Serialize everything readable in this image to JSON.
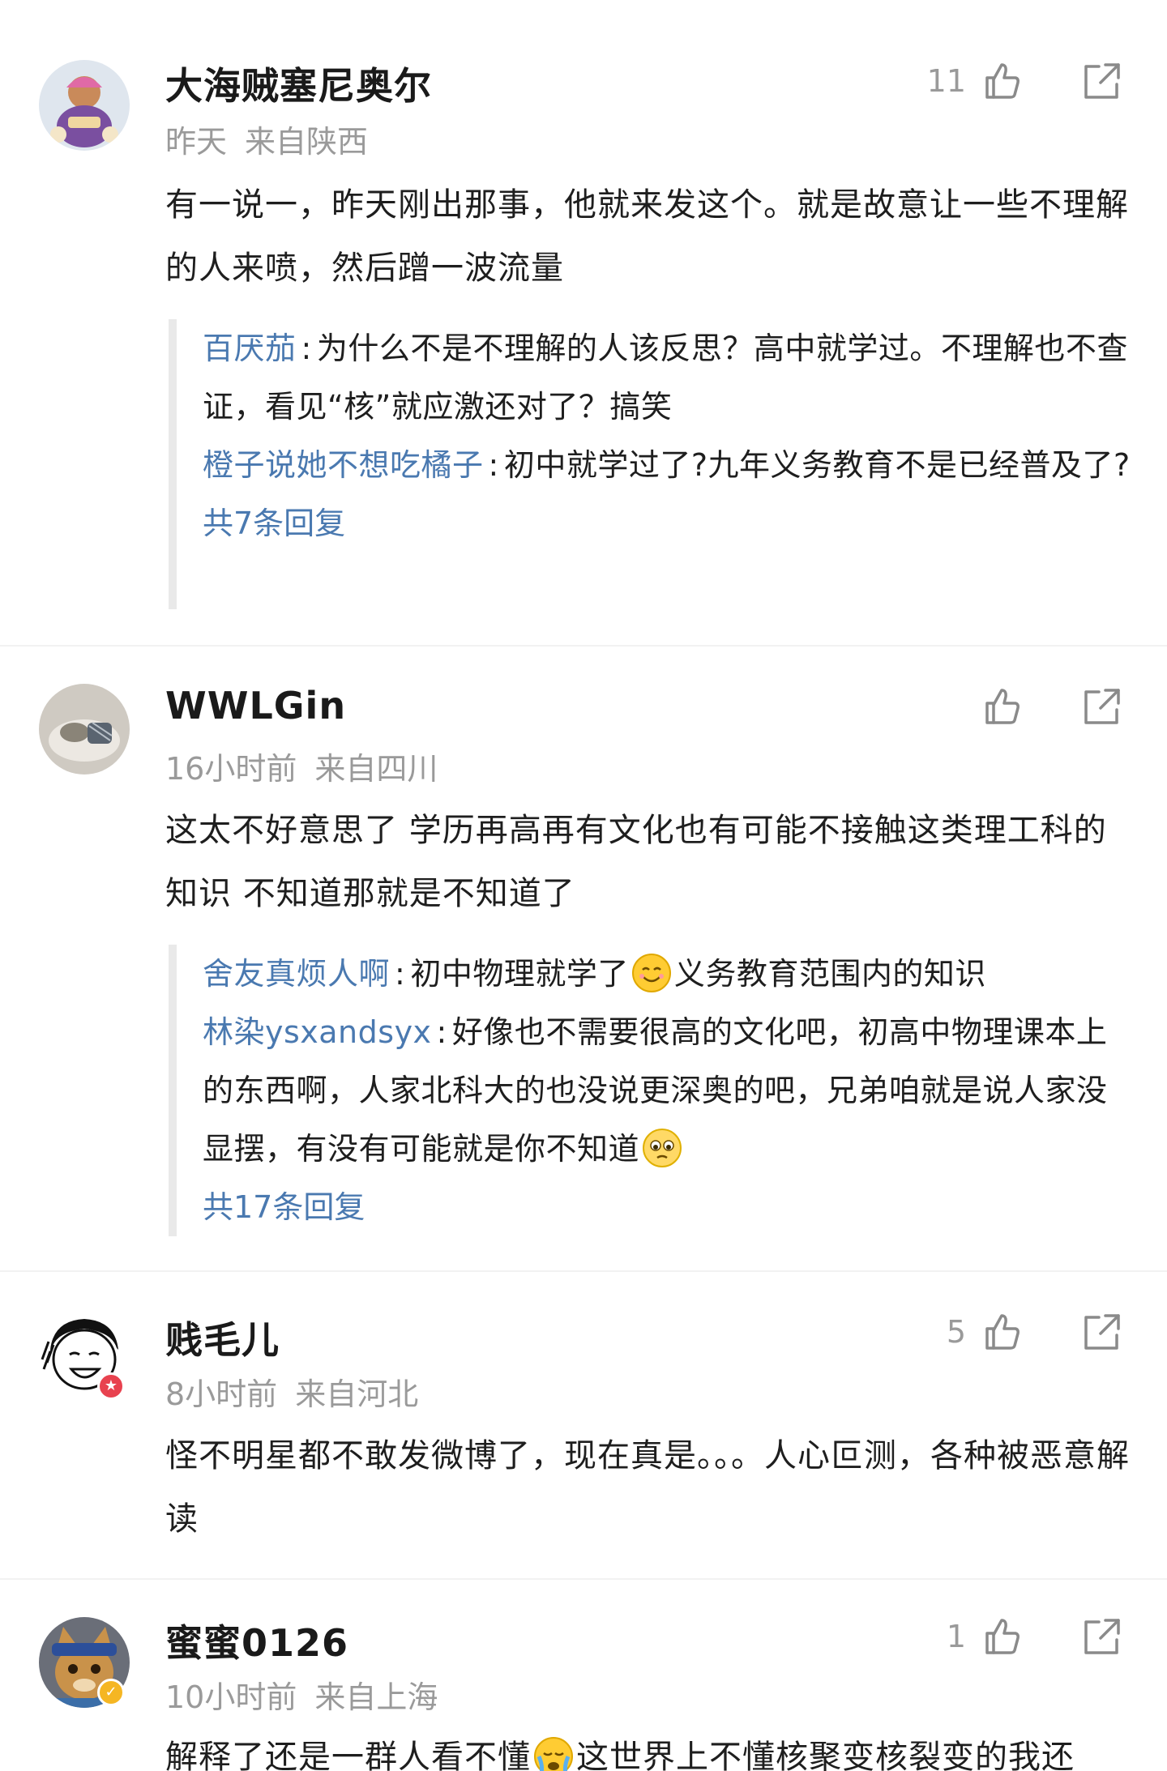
{
  "comments": [
    {
      "username": "大海贼塞尼奥尔",
      "time": "昨天",
      "location": "来自陕西",
      "likes": "11",
      "text": "有一说一，昨天刚出那事，他就来发这个。就是故意让一些不理解的人来喷，然后蹭一波流量",
      "replies": [
        {
          "name": "百厌茄",
          "text": "为什么不是不理解的人该反思？高中就学过。不理解也不查证，看见“核”就应激还对了？搞笑"
        },
        {
          "name": "橙子说她不想吃橘子",
          "text": "初中就学过了?九年义务教育不是已经普及了?"
        }
      ],
      "total_replies": "共7条回复"
    },
    {
      "username": "WWLGin",
      "time": "16小时前",
      "location": "来自四川",
      "likes": "",
      "text": "这太不好意思了 学历再高再有文化也有可能不接触这类理工科的知识 不知道那就是不知道了",
      "replies": [
        {
          "name": "舍友真烦人啊",
          "text_a": "初中物理就学了",
          "emoji": "smile-emoji",
          "text_b": "义务教育范围内的知识"
        },
        {
          "name": "林染ysxandsyx",
          "text_a": "好像也不需要很高的文化吧，初高中物理课本上的东西啊，人家北科大的也没说更深奥的吧，兄弟咱就是说人家没显摆，有没有可能就是你不知道",
          "emoji": "pleading-emoji",
          "text_b": ""
        }
      ],
      "total_replies": "共17条回复"
    },
    {
      "username": "贱毛儿",
      "time": "8小时前",
      "location": "来自河北",
      "likes": "5",
      "text": "怪不明星都不敢发微博了，现在真是。。。人心叵测，各种被恶意解读"
    },
    {
      "username": "蜜蜜0126",
      "time": "10小时前",
      "location": "来自上海",
      "likes": "1",
      "text_a": "解释了还是一群人看不懂",
      "emoji": "crying-emoji",
      "text_b": "这世界上不懂核聚变核裂变的我还"
    }
  ],
  "colors": {
    "link": "#4a79b0",
    "meta": "#9a9a9a",
    "badge_red": "#e8424f",
    "badge_gold": "#f5b623"
  }
}
